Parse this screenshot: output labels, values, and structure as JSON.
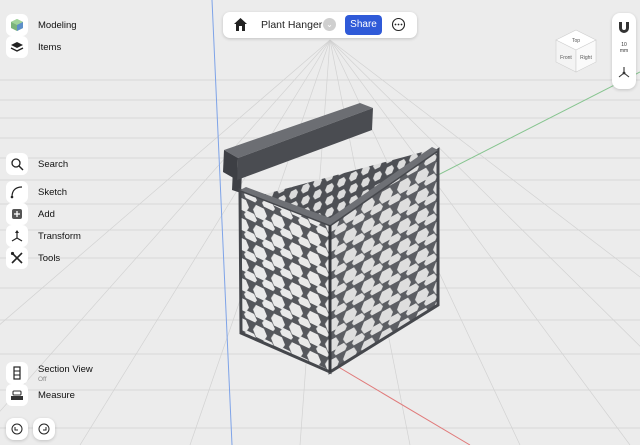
{
  "topbar": {
    "home_icon": "home-icon",
    "title": "Plant Hanger",
    "share_label": "Share",
    "more_icon": "more-horizontal-icon"
  },
  "sidebar_top": {
    "modeling": {
      "label": "Modeling",
      "icon": "cube-icon"
    },
    "items": {
      "label": "Items",
      "icon": "layers-icon"
    }
  },
  "tools": [
    {
      "label": "Search",
      "icon": "search-icon"
    },
    {
      "label": "Sketch",
      "icon": "sketch-icon"
    },
    {
      "label": "Add",
      "icon": "add-icon"
    },
    {
      "label": "Transform",
      "icon": "transform-icon"
    },
    {
      "label": "Tools",
      "icon": "tools-icon"
    }
  ],
  "bottom": {
    "section_view": {
      "label": "Section View",
      "status": "Off",
      "icon": "section-view-icon"
    },
    "measure": {
      "label": "Measure",
      "icon": "ruler-icon"
    },
    "undo_icon": "undo-icon",
    "redo_icon": "redo-icon"
  },
  "rightbar": {
    "magnet_icon": "magnet-icon",
    "unit_value": "10",
    "unit_label": "mm",
    "origin_icon": "axes-icon"
  },
  "viewcube": {
    "front": "Front",
    "right": "Right",
    "top": "Top"
  },
  "colors": {
    "accent": "#2f5ad8",
    "model": "#55575c",
    "grid": "#d6d6d6",
    "background": "#ececec"
  }
}
